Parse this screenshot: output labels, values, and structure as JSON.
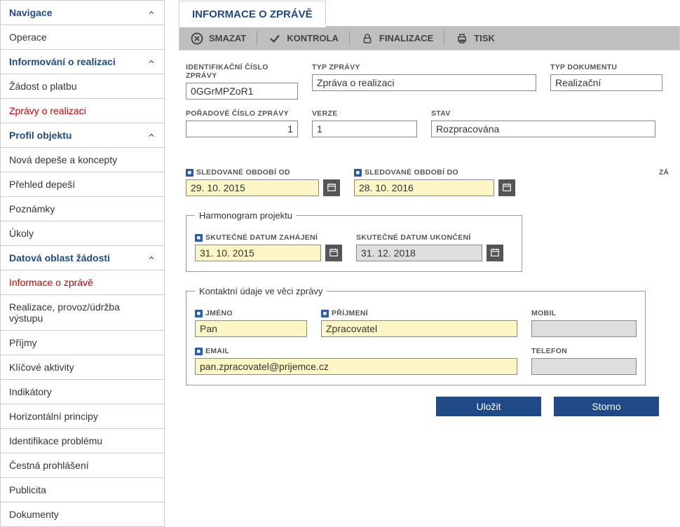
{
  "sidebar": {
    "items": [
      {
        "label": "Navigace",
        "type": "header",
        "expand": true
      },
      {
        "label": "Operace",
        "type": "item"
      },
      {
        "label": "Informování o realizaci",
        "type": "header",
        "expand": true
      },
      {
        "label": "Žádost o platbu",
        "type": "item"
      },
      {
        "label": "Zprávy o realizaci",
        "type": "red"
      },
      {
        "label": "Profil objektu",
        "type": "header",
        "expand": true
      },
      {
        "label": "Nová depeše a koncepty",
        "type": "item"
      },
      {
        "label": "Přehled depeší",
        "type": "item"
      },
      {
        "label": "Poznámky",
        "type": "item"
      },
      {
        "label": "Úkoly",
        "type": "item"
      },
      {
        "label": "Datová oblast žádosti",
        "type": "header",
        "expand": true
      },
      {
        "label": "Informace o zprávě",
        "type": "red"
      },
      {
        "label": "Realizace, provoz/údržba výstupu",
        "type": "item"
      },
      {
        "label": "Příjmy",
        "type": "item"
      },
      {
        "label": "Klíčové aktivity",
        "type": "item"
      },
      {
        "label": "Indikátory",
        "type": "item"
      },
      {
        "label": "Horizontální principy",
        "type": "item"
      },
      {
        "label": "Identifikace problému",
        "type": "item"
      },
      {
        "label": "Čestná prohlášení",
        "type": "item"
      },
      {
        "label": "Publicita",
        "type": "item"
      },
      {
        "label": "Dokumenty",
        "type": "item"
      }
    ]
  },
  "tab_title": "INFORMACE O ZPRÁVĚ",
  "toolbar": {
    "smazat": "SMAZAT",
    "kontrola": "KONTROLA",
    "finalizace": "FINALIZACE",
    "tisk": "TISK"
  },
  "form": {
    "id_label": "IDENTIFIKAČNÍ ČÍSLO ZPRÁVY",
    "id_value": "0GGrMPZoR1",
    "typ_zpravy_label": "TYP ZPRÁVY",
    "typ_zpravy_value": "Zpráva o realizaci",
    "typ_dok_label": "TYP DOKUMENTU",
    "typ_dok_value": "Realizační",
    "poradove_label": "POŘADOVÉ ČÍSLO ZPRÁVY",
    "poradove_value": "1",
    "verze_label": "VERZE",
    "verze_value": "1",
    "stav_label": "STAV",
    "stav_value": "Rozpracována",
    "od_label": "SLEDOVANÉ OBDOBÍ OD",
    "od_value": "29. 10. 2015",
    "do_label": "SLEDOVANÉ OBDOBÍ DO",
    "do_value": "28. 10. 2016",
    "zal_label": "ZÁ",
    "harmonogram_legend": "Harmonogram projektu",
    "zahajeni_label": "SKUTEČNÉ DATUM ZAHÁJENÍ",
    "zahajeni_value": "31. 10. 2015",
    "ukonceni_label": "SKUTEČNÉ DATUM UKONČENÍ",
    "ukonceni_value": "31. 12. 2018",
    "kontakt_legend": "Kontaktní údaje ve věci zprávy",
    "jmeno_label": "JMÉNO",
    "jmeno_value": "Pan",
    "prijmeni_label": "PŘÍJMENÍ",
    "prijmeni_value": "Zpracovatel",
    "mobil_label": "MOBIL",
    "mobil_value": "",
    "email_label": "EMAIL",
    "email_value": "pan.zpracovatel@prijemce.cz",
    "telefon_label": "TELEFON",
    "telefon_value": ""
  },
  "buttons": {
    "save": "Uložit",
    "cancel": "Storno"
  }
}
